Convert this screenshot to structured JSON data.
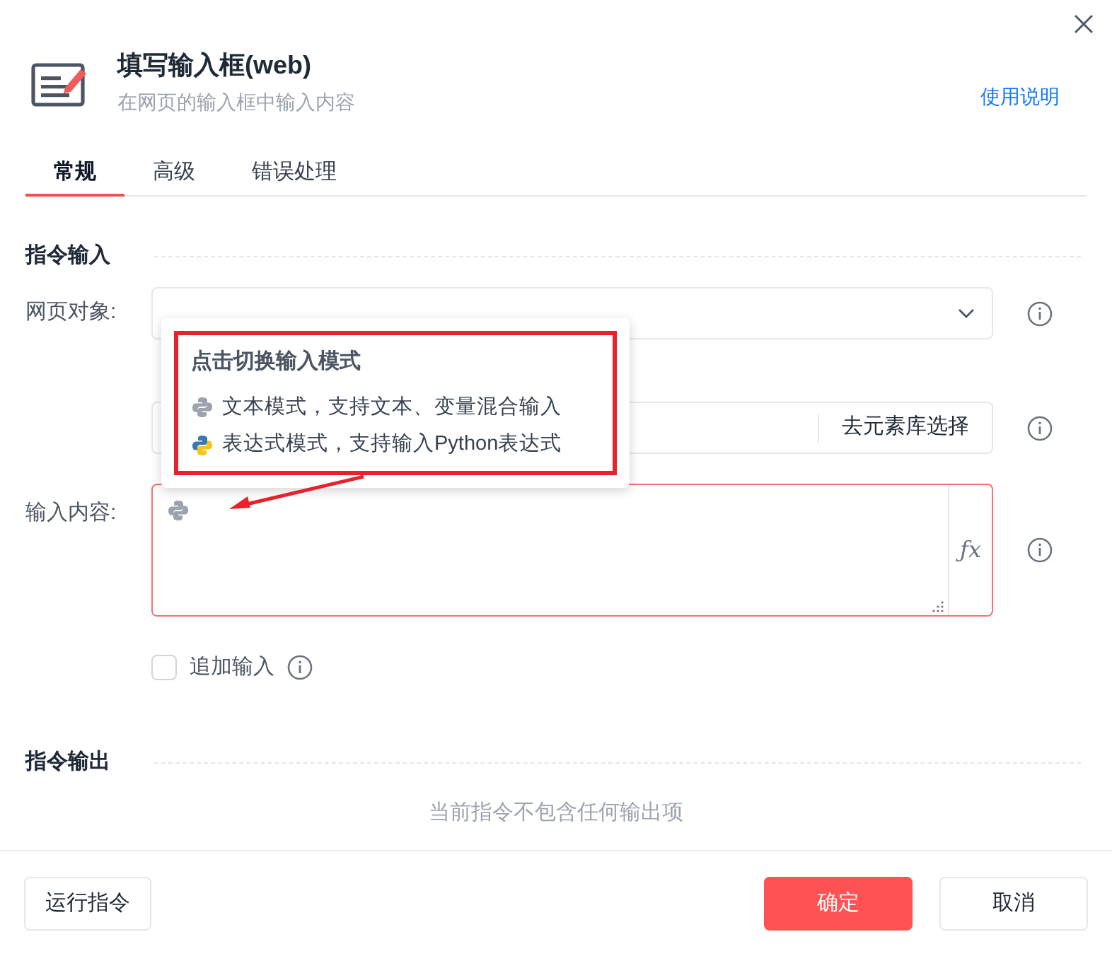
{
  "header": {
    "title": "填写输入框(web)",
    "subtitle": "在网页的输入框中输入内容",
    "help_link": "使用说明"
  },
  "tabs": [
    {
      "label": "常规",
      "selected": true
    },
    {
      "label": "高级",
      "selected": false
    },
    {
      "label": "错误处理",
      "selected": false
    }
  ],
  "input_section": {
    "title": "指令输入",
    "fields": [
      {
        "kind": "select",
        "label": "网页对象:"
      },
      {
        "kind": "picker",
        "button": "去元素库选择"
      },
      {
        "kind": "textarea",
        "label": "输入内容:",
        "fx": "ƒx",
        "error": true
      }
    ],
    "append": {
      "label": "追加输入",
      "checked": false
    }
  },
  "tooltip": {
    "title": "点击切换输入模式",
    "items": [
      {
        "kind": "text",
        "text": "文本模式，支持文本、变量混合输入"
      },
      {
        "kind": "python",
        "text": "表达式模式，支持输入Python表达式"
      }
    ]
  },
  "output_section": {
    "title": "指令输出",
    "empty": "当前指令不包含任何输出项"
  },
  "footer": {
    "run": "运行指令",
    "ok": "确定",
    "cancel": "取消"
  }
}
